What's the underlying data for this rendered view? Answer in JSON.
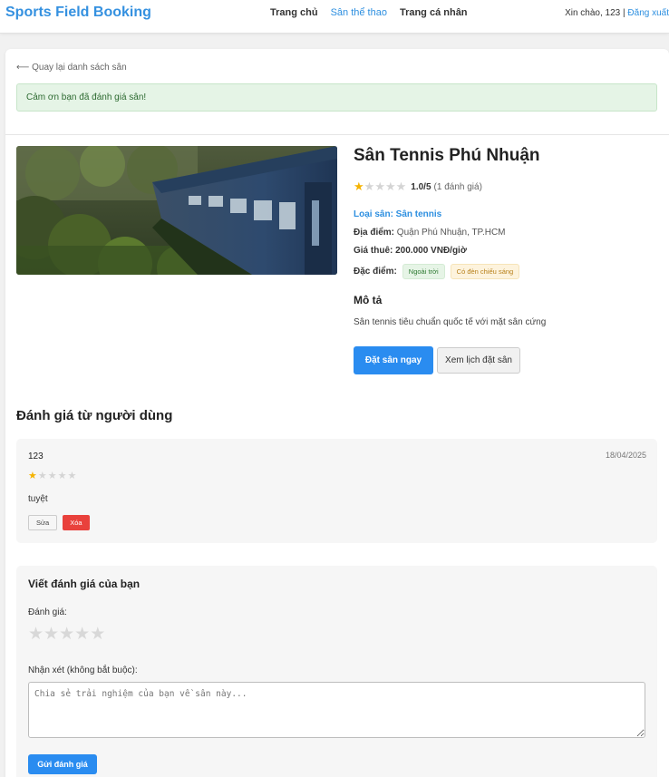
{
  "nav": {
    "brand": "Sports Field Booking",
    "links": [
      "Trang chủ",
      "Sân thể thao",
      "Trang cá nhân"
    ],
    "active_index": 1,
    "greeting": "Xin chào, 123 |",
    "logout": "Đăng xuất"
  },
  "page": {
    "back_link": "⟵ Quay lại danh sách sân",
    "alert": "Cảm ơn bạn đã đánh giá sân!"
  },
  "field": {
    "name": "Sân Tennis Phú Nhuận",
    "rating": 1,
    "rating_max": 5,
    "score": "1.0/5",
    "rating_count": "(1 đánh giá)",
    "sport": "Loại sân: Sân tennis",
    "location_label": "Địa điểm:",
    "location": "Quận Phú Nhuận, TP.HCM",
    "price_label": "Giá thuê:",
    "price": "200.000  VNĐ/giờ",
    "features_label": "Đặc điểm:",
    "features": [
      "Ngoài trời",
      "Có đèn chiếu sáng"
    ],
    "description_title": "Mô tả",
    "description": "Sân tennis tiêu chuẩn quốc tế với mặt sân cứng",
    "book_button": "Đặt sân ngay",
    "schedule_button": "Xem lịch đặt sân"
  },
  "reviews": {
    "title": "Đánh giá từ người dùng",
    "items": [
      {
        "user": "123",
        "date": "18/04/2025",
        "stars": 1,
        "text": "tuyệt",
        "edit_label": "Sửa",
        "delete_label": "Xóa"
      }
    ]
  },
  "review_form": {
    "title": "Viết đánh giá của bạn",
    "rating_label": "Đánh giá:",
    "comment_label": "Nhận xét (không bắt buộc):",
    "placeholder": "Chia sẻ trải nghiệm của bạn về sân này...",
    "submit": "Gửi đánh giá"
  },
  "colors": {
    "brand": "#3591e0",
    "primary_button": "#2a8cf0",
    "star_active": "#f5b301",
    "delete_button": "#e9413c",
    "alert_bg": "#e5f4e6"
  },
  "icons": {
    "star": "★",
    "back_arrow": "⟵"
  }
}
